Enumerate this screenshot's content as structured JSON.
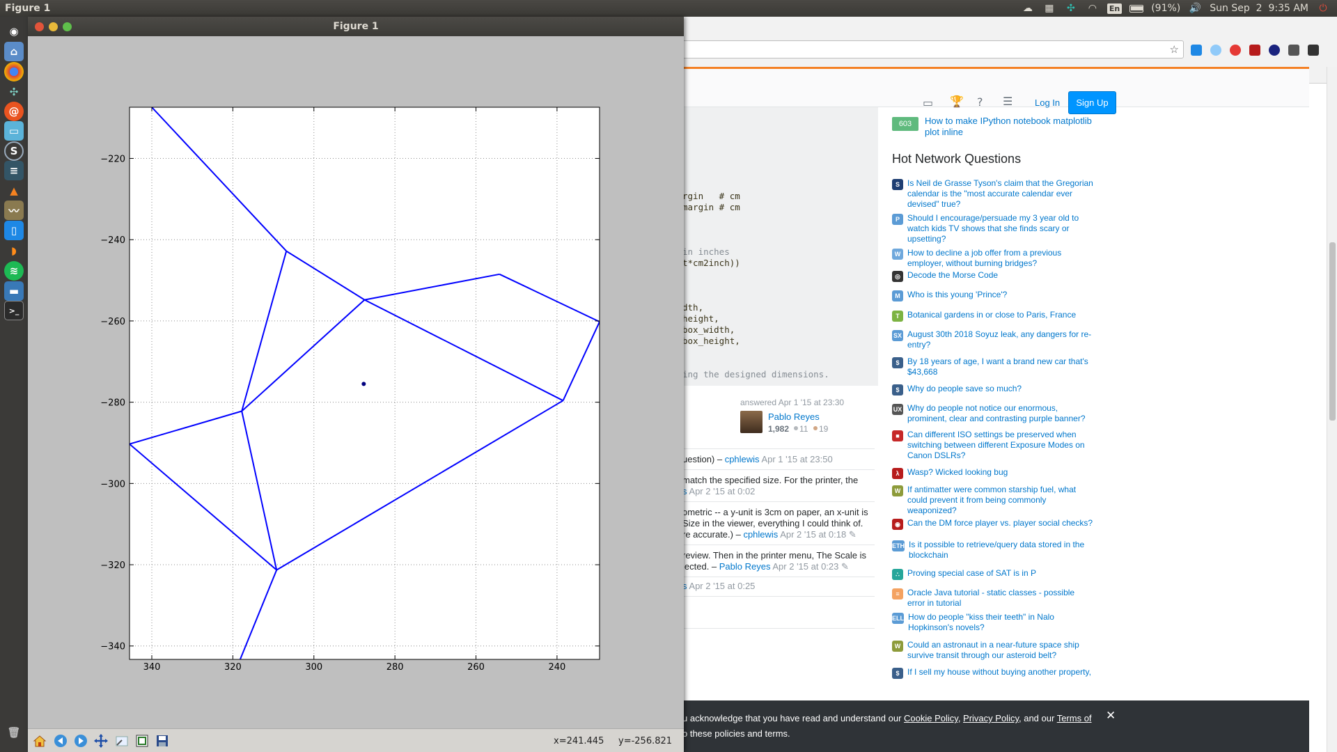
{
  "top_panel": {
    "app_title": "Figure 1",
    "lang": "En",
    "battery": "(91%)",
    "clock": "Sun Sep  2  9:35 AM"
  },
  "figure": {
    "window_title": "Figure 1",
    "status": {
      "x": "x=241.445",
      "y": "y=-256.821"
    }
  },
  "chart_data": {
    "type": "line",
    "title": "",
    "xlabel": "",
    "ylabel": "",
    "xlim": [
      345.5,
      229.5
    ],
    "ylim": [
      -343.3,
      -207.4
    ],
    "x_ticks": [
      340,
      320,
      300,
      280,
      260,
      240
    ],
    "y_ticks": [
      -220,
      -240,
      -260,
      -280,
      -300,
      -320,
      -340
    ],
    "x_tick_labels": [
      "340",
      "320",
      "300",
      "280",
      "260",
      "240"
    ],
    "y_tick_labels": [
      "−220",
      "−240",
      "−260",
      "−280",
      "−300",
      "−320",
      "−340"
    ],
    "grid": true,
    "line_color": "#0000ff",
    "series": [
      {
        "values": [
          [
            340.0,
            -207.4
          ],
          [
            306.8,
            -242.8
          ]
        ]
      },
      {
        "values": [
          [
            306.8,
            -242.8
          ],
          [
            287.5,
            -254.8
          ]
        ]
      },
      {
        "values": [
          [
            306.8,
            -242.8
          ],
          [
            317.8,
            -282.2
          ]
        ]
      },
      {
        "values": [
          [
            287.5,
            -254.8
          ],
          [
            254.2,
            -248.5
          ]
        ]
      },
      {
        "values": [
          [
            254.2,
            -248.5
          ],
          [
            229.5,
            -260.2
          ]
        ]
      },
      {
        "values": [
          [
            287.5,
            -254.8
          ],
          [
            238.5,
            -279.6
          ]
        ]
      },
      {
        "values": [
          [
            229.5,
            -260.2
          ],
          [
            238.5,
            -279.6
          ]
        ]
      },
      {
        "values": [
          [
            287.5,
            -254.8
          ],
          [
            317.8,
            -282.2
          ]
        ]
      },
      {
        "values": [
          [
            317.8,
            -282.2
          ],
          [
            345.5,
            -290.3
          ]
        ]
      },
      {
        "values": [
          [
            317.8,
            -282.2
          ],
          [
            309.2,
            -321.3
          ]
        ]
      },
      {
        "values": [
          [
            345.5,
            -290.3
          ],
          [
            309.2,
            -321.3
          ]
        ]
      },
      {
        "values": [
          [
            238.5,
            -279.6
          ],
          [
            309.2,
            -321.3
          ]
        ]
      },
      {
        "values": [
          [
            309.2,
            -321.3
          ],
          [
            318.2,
            -343.3
          ]
        ]
      }
    ],
    "points": [
      [
        287.7,
        -275.5
      ]
    ],
    "point_color": "#00007f"
  },
  "browser": {
    "so": {
      "login": "Log In",
      "signup": "Sign Up"
    },
    "code_lines": [
      "rgin   # cm",
      "margin # cm",
      "in inches",
      "t*cm2inch))",
      "dth,",
      "height,",
      "box_width,",
      "box_height,",
      "ing the designed dimensions."
    ],
    "answer": {
      "answered": "answered Apr 1 '15 at 23:30",
      "user": "Pablo Reyes",
      "rep": "1,982",
      "silver": "11",
      "bronze": "19"
    },
    "comments": {
      "c1_text": "uestion) – ",
      "c1_user": "cphlewis",
      "c1_date": "Apr 1 '15 at 23:50",
      "c2_line1": "match the specified size. For the printer, the",
      "c2_link": "s",
      "c2_date": "Apr 2 '15 at 0:02",
      "c3_line1": "ometric -- a y-unit is 3cm on paper, an x-unit is",
      "c3_line2": "Size in the viewer, everything I could think of.",
      "c3_line3": "re accurate.) – ",
      "c3_user": "cphlewis",
      "c3_date": "Apr 2 '15 at 0:18",
      "c4_line1": "review. Then in the printer menu, The Scale is",
      "c4_line2": "lected. – ",
      "c4_user": "Pablo Reyes",
      "c4_date": "Apr 2 '15 at 0:23",
      "c5_link": "s",
      "c5_date": "Apr 2 '15 at 0:25"
    },
    "linked": {
      "score": "603",
      "title_line1": "How to make IPython notebook matplotlib",
      "title_line2": "plot inline"
    },
    "hnq_title": "Hot Network Questions",
    "hnq": [
      {
        "text": "Is Neil de Grasse Tyson's claim that the Gregorian calendar is the \"most accurate calendar ever devised\" true?",
        "icon_color": "#1e3e72",
        "glyph": "S"
      },
      {
        "text": "Should I encourage/persuade my 3 year old to watch kids TV shows that she finds scary or upsetting?",
        "icon_color": "#5b9bd5",
        "glyph": "P"
      },
      {
        "text": "How to decline a job offer from a previous employer, without burning bridges?",
        "icon_color": "#6fa8dc",
        "glyph": "W"
      },
      {
        "text": "Decode the Morse Code",
        "icon_color": "#333333",
        "glyph": "◎"
      },
      {
        "text": "Who is this young 'Prince'?",
        "icon_color": "#5b9bd5",
        "glyph": "M"
      },
      {
        "text": "Botanical gardens in or close to Paris, France",
        "icon_color": "#7cb342",
        "glyph": "T"
      },
      {
        "text": "August 30th 2018 Soyuz leak, any dangers for re-entry?",
        "icon_color": "#5b9bd5",
        "glyph": "SX"
      },
      {
        "text": "By 18 years of age, I want a brand new car that's $43,668",
        "icon_color": "#3a5f8a",
        "glyph": "$"
      },
      {
        "text": "Why do people save so much?",
        "icon_color": "#3a5f8a",
        "glyph": "$"
      },
      {
        "text": "Why do people not notice our enormous, prominent, clear and contrasting purple banner?",
        "icon_color": "#555555",
        "glyph": "UX"
      },
      {
        "text": "Can different ISO settings be preserved when switching between different Exposure Modes on Canon DSLRs?",
        "icon_color": "#c62828",
        "glyph": "■"
      },
      {
        "text": "Wasp? Wicked looking bug",
        "icon_color": "#b71c1c",
        "glyph": "λ"
      },
      {
        "text": "If antimatter were common starship fuel, what could prevent it from being commonly weaponized?",
        "icon_color": "#8d9b3a",
        "glyph": "W"
      },
      {
        "text": "Can the DM force player vs. player social checks?",
        "icon_color": "#b71c1c",
        "glyph": "◉"
      },
      {
        "text": "Is it possible to retrieve/query data stored in the blockchain",
        "icon_color": "#5b9bd5",
        "glyph": "ETH"
      },
      {
        "text": "Proving special case of SAT is in P",
        "icon_color": "#26a69a",
        "glyph": "∴"
      },
      {
        "text": "Oracle Java tutorial - static classes - possible error in tutorial",
        "icon_color": "#f4a261",
        "glyph": "≡"
      },
      {
        "text": "How do people \"kiss their teeth\" in Nalo Hopkinson's novels?",
        "icon_color": "#5b9bd5",
        "glyph": "ELL"
      },
      {
        "text": "Could an astronaut in a near-future space ship survive transit through our asteroid belt?",
        "icon_color": "#8d9b3a",
        "glyph": "W"
      },
      {
        "text": "If I sell my house without buying another property,",
        "icon_color": "#3a5f8a",
        "glyph": "$"
      }
    ],
    "cookie": {
      "prefix": "u acknowledge that you have read and understand our ",
      "cookie_policy": "Cookie Policy",
      "sep": ", ",
      "privacy_policy": "Privacy Policy",
      "and": ", and our ",
      "terms": "Terms of",
      "line2": "o these policies and terms.",
      "close": "✕"
    }
  }
}
